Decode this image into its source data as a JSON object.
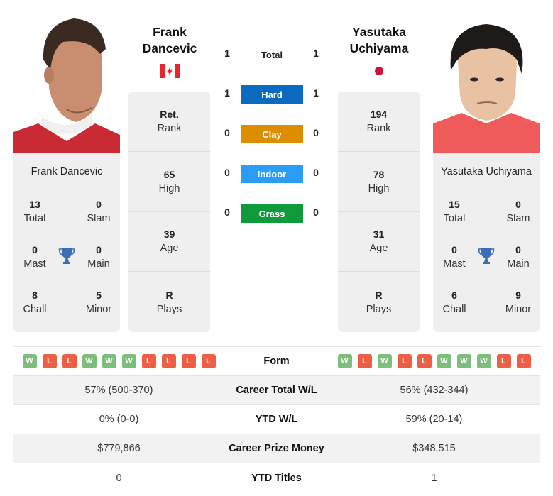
{
  "players": {
    "left": {
      "name": "Frank Dancevic",
      "name_line1": "Frank",
      "name_line2": "Dancevic",
      "country_flag": "canada-flag",
      "rank": "Ret.",
      "rank_label": "Rank",
      "high": "65",
      "high_label": "High",
      "age": "39",
      "age_label": "Age",
      "plays": "R",
      "plays_label": "Plays",
      "titles": {
        "total": "13",
        "total_label": "Total",
        "slam": "0",
        "slam_label": "Slam",
        "mast": "0",
        "mast_label": "Mast",
        "main": "0",
        "main_label": "Main",
        "chall": "8",
        "chall_label": "Chall",
        "minor": "5",
        "minor_label": "Minor"
      },
      "form": [
        "W",
        "L",
        "L",
        "W",
        "W",
        "W",
        "L",
        "L",
        "L",
        "L"
      ]
    },
    "right": {
      "name": "Yasutaka Uchiyama",
      "name_line1": "Yasutaka",
      "name_line2": "Uchiyama",
      "country_flag": "japan-flag",
      "rank": "194",
      "rank_label": "Rank",
      "high": "78",
      "high_label": "High",
      "age": "31",
      "age_label": "Age",
      "plays": "R",
      "plays_label": "Plays",
      "titles": {
        "total": "15",
        "total_label": "Total",
        "slam": "0",
        "slam_label": "Slam",
        "mast": "0",
        "mast_label": "Mast",
        "main": "0",
        "main_label": "Main",
        "chall": "6",
        "chall_label": "Chall",
        "minor": "9",
        "minor_label": "Minor"
      },
      "form": [
        "W",
        "L",
        "W",
        "L",
        "L",
        "W",
        "W",
        "W",
        "L",
        "L"
      ]
    }
  },
  "h2h": [
    {
      "label": "Total",
      "left": "1",
      "right": "1",
      "color": ""
    },
    {
      "label": "Hard",
      "left": "1",
      "right": "1",
      "color": "#0a6abf"
    },
    {
      "label": "Clay",
      "left": "0",
      "right": "0",
      "color": "#dd8e00"
    },
    {
      "label": "Indoor",
      "left": "0",
      "right": "0",
      "color": "#2b9df4"
    },
    {
      "label": "Grass",
      "left": "0",
      "right": "0",
      "color": "#0f9a3b"
    }
  ],
  "stats": {
    "form_label": "Form",
    "rows": [
      {
        "label": "Career Total W/L",
        "left": "57% (500-370)",
        "right": "56% (432-344)"
      },
      {
        "label": "YTD W/L",
        "left": "0% (0-0)",
        "right": "59% (20-14)"
      },
      {
        "label": "Career Prize Money",
        "left": "$779,866",
        "right": "$348,515"
      },
      {
        "label": "YTD Titles",
        "left": "0",
        "right": "1"
      }
    ]
  },
  "colors": {
    "win": "#7cbf7c",
    "loss": "#ee5e45",
    "trophy": "#3a6fb8"
  }
}
